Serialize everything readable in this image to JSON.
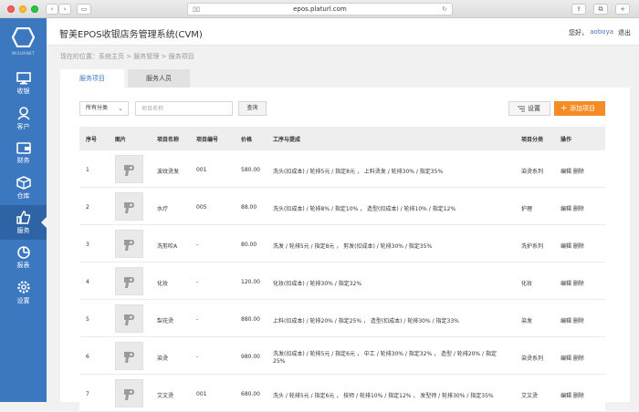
{
  "browser": {
    "url": "epos.platurl.com"
  },
  "logo": {
    "text": "WISURNET"
  },
  "nav": [
    {
      "label": "收银",
      "icon": "monitor-icon",
      "key": "cashier"
    },
    {
      "label": "客户",
      "icon": "user-icon",
      "key": "customer"
    },
    {
      "label": "财务",
      "icon": "wallet-icon",
      "key": "finance"
    },
    {
      "label": "仓库",
      "icon": "box-icon",
      "key": "warehouse"
    },
    {
      "label": "服务",
      "icon": "thumbs-up-icon",
      "key": "service"
    },
    {
      "label": "报表",
      "icon": "pie-chart-icon",
      "key": "report"
    },
    {
      "label": "设置",
      "icon": "gear-icon",
      "key": "settings"
    }
  ],
  "header": {
    "title": "智美EPOS收银店务管理系统(CVM)",
    "hello": "您好，",
    "user": "aoboya",
    "logout": "退出"
  },
  "breadcrumb": "现在的位置：系统主页 > 服务管理 > 服务项目",
  "tabs": [
    "服务项目",
    "服务人员"
  ],
  "toolbar": {
    "category": "所有分类",
    "search_placeholder": "项目名称",
    "query": "查询",
    "settings": "设置",
    "add": "添加项目"
  },
  "table": {
    "headers": [
      "序号",
      "图片",
      "项目名称",
      "项目编号",
      "价格",
      "工序与提成",
      "项目分类",
      "操作"
    ],
    "rows": [
      {
        "no": "1",
        "name": "波纹烫发",
        "code": "001",
        "price": "580.00",
        "process": "洗头(扣成本) / 轮排5元 / 指定8元 ， 上料烫发 / 轮排30% / 指定35%",
        "process2": "",
        "category": "染烫系列",
        "ops": "编辑 删除"
      },
      {
        "no": "2",
        "name": "水疗",
        "code": "005",
        "price": "88.00",
        "process": "洗头(扣成本) / 轮排8% / 指定10% ， 造型(扣成本) / 轮排10% / 指定12%",
        "process2": "",
        "category": "护理",
        "ops": "编辑 删除"
      },
      {
        "no": "3",
        "name": "洗剪吹A",
        "code": "-",
        "price": "80.00",
        "process": "洗发 / 轮排5元 / 指定8元 ， 剪发(扣成本) / 轮排30% / 指定35%",
        "process2": "",
        "category": "洗护系列",
        "ops": "编辑 删除"
      },
      {
        "no": "4",
        "name": "化妆",
        "code": "-",
        "price": "120.00",
        "process": "化妆(扣成本) / 轮排30% / 指定32%",
        "process2": "",
        "category": "化妆",
        "ops": "编辑 删除"
      },
      {
        "no": "5",
        "name": "梨花烫",
        "code": "-",
        "price": "880.00",
        "process": "上料(扣成本) / 轮排20% / 指定25% ， 造型(扣成本) / 轮排30% / 指定33%",
        "process2": "",
        "category": "染发",
        "ops": "编辑 删除"
      },
      {
        "no": "6",
        "name": "染烫",
        "code": "-",
        "price": "980.00",
        "process": "洗发(扣成本) / 轮排5元 / 指定6元 ， 中工 / 轮排30% / 指定32% ， 造型 / 轮排20% / 指定",
        "process2": "25%",
        "category": "染烫系列",
        "ops": "编辑 删除"
      },
      {
        "no": "7",
        "name": "艾文烫",
        "code": "001",
        "price": "680.00",
        "process": "洗头 / 轮排5元 / 指定6元 ， 技师 / 轮排10% / 指定12% ， 发型师 / 轮排30% / 指定35%",
        "process2": "",
        "category": "艾文烫",
        "ops": "编辑 删除"
      }
    ]
  }
}
